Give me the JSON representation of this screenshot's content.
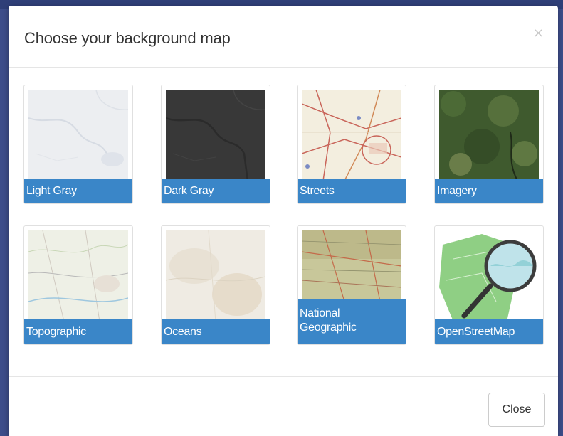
{
  "modal": {
    "title": "Choose your background map",
    "close_x": "×",
    "close_button_label": "Close"
  },
  "basemaps": [
    {
      "label": "Light Gray",
      "icon": "light-gray-map-thumbnail"
    },
    {
      "label": "Dark Gray",
      "icon": "dark-gray-map-thumbnail"
    },
    {
      "label": "Streets",
      "icon": "streets-map-thumbnail"
    },
    {
      "label": "Imagery",
      "icon": "imagery-map-thumbnail"
    },
    {
      "label": "Topographic",
      "icon": "topographic-map-thumbnail"
    },
    {
      "label": "Oceans",
      "icon": "oceans-map-thumbnail"
    },
    {
      "label": "National Geographic",
      "label_line1": "National",
      "label_line2": "Geographic",
      "icon": "national-geographic-map-thumbnail"
    },
    {
      "label": "OpenStreetMap",
      "icon": "openstreetmap-logo"
    }
  ],
  "colors": {
    "label_background": "#3a86c8",
    "backdrop": "#3d4d8a"
  }
}
